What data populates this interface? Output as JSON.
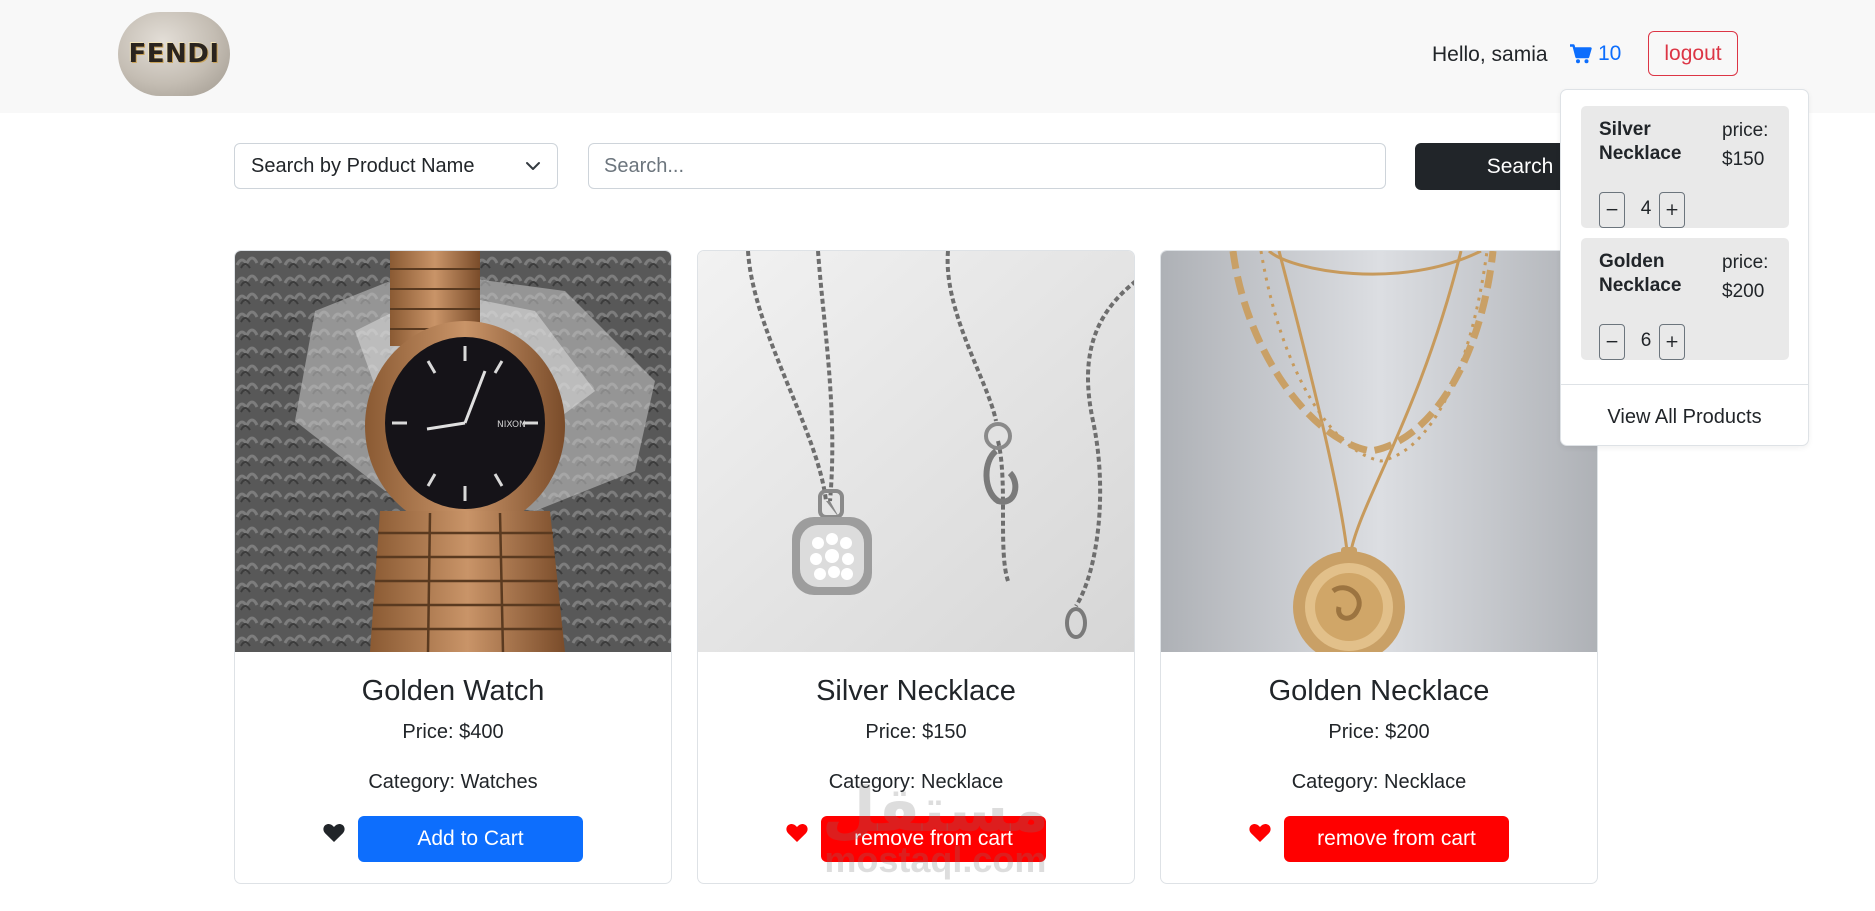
{
  "header": {
    "logo_text": "FENDI",
    "greeting": "Hello, samia",
    "cart_count": "10",
    "logout_label": "logout"
  },
  "search": {
    "filter_selected": "Search by Product Name",
    "placeholder": "Search...",
    "button_label": "Search"
  },
  "products": [
    {
      "name": "Golden Watch",
      "price": "Price: $400",
      "category": "Category: Watches",
      "favorite": false,
      "action_label": "Add to Cart",
      "image_icon": "watch-image"
    },
    {
      "name": "Silver Necklace",
      "price": "Price: $150",
      "category": "Category: Necklace",
      "favorite": true,
      "action_label": "remove from cart",
      "image_icon": "silver-necklace-image"
    },
    {
      "name": "Golden Necklace",
      "price": "Price: $200",
      "category": "Category: Necklace",
      "favorite": true,
      "action_label": "remove from cart",
      "image_icon": "golden-necklace-image"
    }
  ],
  "cart_dropdown": {
    "items": [
      {
        "name": "Silver Necklace",
        "price_label": "price:",
        "price": "$150",
        "quantity": "4",
        "minus": "−",
        "plus": "+"
      },
      {
        "name": "Golden Necklace",
        "price_label": "price:",
        "price": "$200",
        "quantity": "6",
        "minus": "−",
        "plus": "+"
      }
    ],
    "view_all_label": "View All Products"
  },
  "watermark": {
    "arabic": "مستقل",
    "latin": "mostaql.com"
  },
  "colors": {
    "primary": "#0d6efd",
    "danger": "#ff0000",
    "logout": "#dc3545",
    "dark": "#212529",
    "navbar_bg": "#f8f8f8"
  }
}
